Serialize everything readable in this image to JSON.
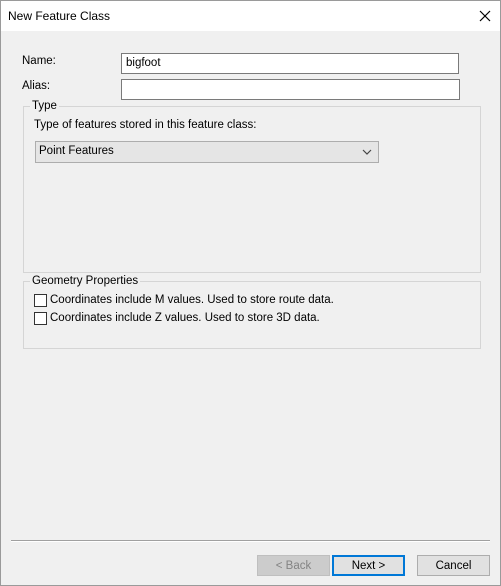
{
  "window": {
    "title": "New Feature Class",
    "close_icon": "close-icon"
  },
  "form": {
    "name_label": "Name:",
    "name_value": "bigfoot",
    "alias_label": "Alias:",
    "alias_value": ""
  },
  "type_group": {
    "legend": "Type",
    "description": "Type of features stored in this feature class:",
    "selected": "Point Features"
  },
  "geometry_group": {
    "legend": "Geometry Properties",
    "options": [
      {
        "label": "Coordinates include M values. Used to store route data.",
        "checked": false
      },
      {
        "label": "Coordinates include Z values. Used to store 3D data.",
        "checked": false
      }
    ]
  },
  "buttons": {
    "back": "< Back",
    "next": "Next >",
    "cancel": "Cancel"
  },
  "colors": {
    "accent": "#0078d7",
    "dialog_bg": "#f0f0f0"
  }
}
